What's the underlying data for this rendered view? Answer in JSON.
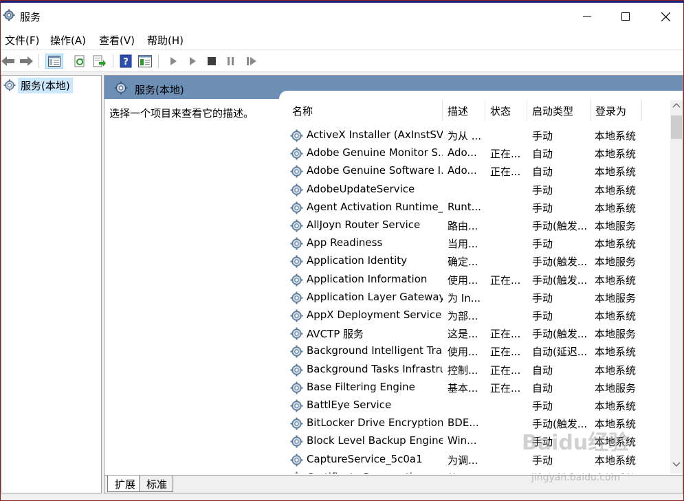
{
  "window": {
    "title": "服务",
    "minimize_glyph": "─",
    "maximize_glyph": "☐",
    "close_glyph": "✕",
    "titlebar_bg": "#ffffff",
    "accent_color": "#1a237e"
  },
  "menu": {
    "items": [
      {
        "label": "文件(F)"
      },
      {
        "label": "操作(A)"
      },
      {
        "label": "查看(V)"
      },
      {
        "label": "帮助(H)"
      }
    ]
  },
  "toolbar": {
    "buttons": [
      "back-arrow-icon",
      "forward-arrow-icon",
      "show-hide-console-tree-icon",
      "refresh-icon",
      "export-list-icon",
      "help-icon",
      "properties-icon",
      "start-service-icon",
      "start-service-alt-icon",
      "stop-service-icon",
      "pause-service-icon",
      "resume-service-icon"
    ]
  },
  "tree": {
    "root_label": "服务(本地)"
  },
  "content": {
    "header_title": "服务(本地)",
    "header_color": "#6d8fb6",
    "description_prompt": "选择一个项目来查看它的描述。",
    "columns": {
      "name": "名称",
      "description": "描述",
      "status": "状态",
      "startup_type": "启动类型",
      "logon_as": "登录为"
    },
    "sort_indicator": "˄",
    "rows": [
      {
        "name": "ActiveX Installer (AxInstSV)",
        "description": "为从 ...",
        "status": "",
        "startup": "手动",
        "logon": "本地系统"
      },
      {
        "name": "Adobe Genuine Monitor S...",
        "description": "Ado...",
        "status": "正在...",
        "startup": "自动",
        "logon": "本地系统"
      },
      {
        "name": "Adobe Genuine Software I...",
        "description": "Ado...",
        "status": "正在...",
        "startup": "自动",
        "logon": "本地系统"
      },
      {
        "name": "AdobeUpdateService",
        "description": "",
        "status": "",
        "startup": "手动",
        "logon": "本地系统"
      },
      {
        "name": "Agent Activation Runtime_...",
        "description": "Runt...",
        "status": "",
        "startup": "手动",
        "logon": "本地系统"
      },
      {
        "name": "AllJoyn Router Service",
        "description": "路由...",
        "status": "",
        "startup": "手动(触发...",
        "logon": "本地服务"
      },
      {
        "name": "App Readiness",
        "description": "当用...",
        "status": "",
        "startup": "手动",
        "logon": "本地系统"
      },
      {
        "name": "Application Identity",
        "description": "确定...",
        "status": "",
        "startup": "手动(触发...",
        "logon": "本地服务"
      },
      {
        "name": "Application Information",
        "description": "使用...",
        "status": "正在...",
        "startup": "手动(触发...",
        "logon": "本地系统"
      },
      {
        "name": "Application Layer Gateway ...",
        "description": "为 In...",
        "status": "",
        "startup": "手动",
        "logon": "本地服务"
      },
      {
        "name": "AppX Deployment Service ...",
        "description": "为部...",
        "status": "",
        "startup": "手动",
        "logon": "本地系统"
      },
      {
        "name": "AVCTP 服务",
        "description": "这是...",
        "status": "正在...",
        "startup": "手动(触发...",
        "logon": "本地服务"
      },
      {
        "name": "Background Intelligent Tra...",
        "description": "使用...",
        "status": "正在...",
        "startup": "自动(延迟...",
        "logon": "本地系统"
      },
      {
        "name": "Background Tasks Infrastru...",
        "description": "控制...",
        "status": "正在...",
        "startup": "自动",
        "logon": "本地系统"
      },
      {
        "name": "Base Filtering Engine",
        "description": "基本...",
        "status": "正在...",
        "startup": "自动",
        "logon": "本地服务"
      },
      {
        "name": "BattlEye Service",
        "description": "",
        "status": "",
        "startup": "手动",
        "logon": "本地系统"
      },
      {
        "name": "BitLocker Drive Encryption ...",
        "description": "BDE...",
        "status": "",
        "startup": "手动(触发...",
        "logon": "本地系统"
      },
      {
        "name": "Block Level Backup Engine ...",
        "description": "Win...",
        "status": "",
        "startup": "手动",
        "logon": "本地系统"
      },
      {
        "name": "CaptureService_5c0a1",
        "description": "为调...",
        "status": "",
        "startup": "手动",
        "logon": "本地系统"
      },
      {
        "name": "Certificate Propagation",
        "description": "将用...",
        "status": "",
        "startup": "手动(触发...",
        "logon": "本地系统"
      }
    ],
    "tabs": [
      {
        "label": "扩展"
      },
      {
        "label": "标准"
      }
    ]
  },
  "watermark": {
    "text": "Baidu经验",
    "sub": "jingyan.baidu.com"
  }
}
